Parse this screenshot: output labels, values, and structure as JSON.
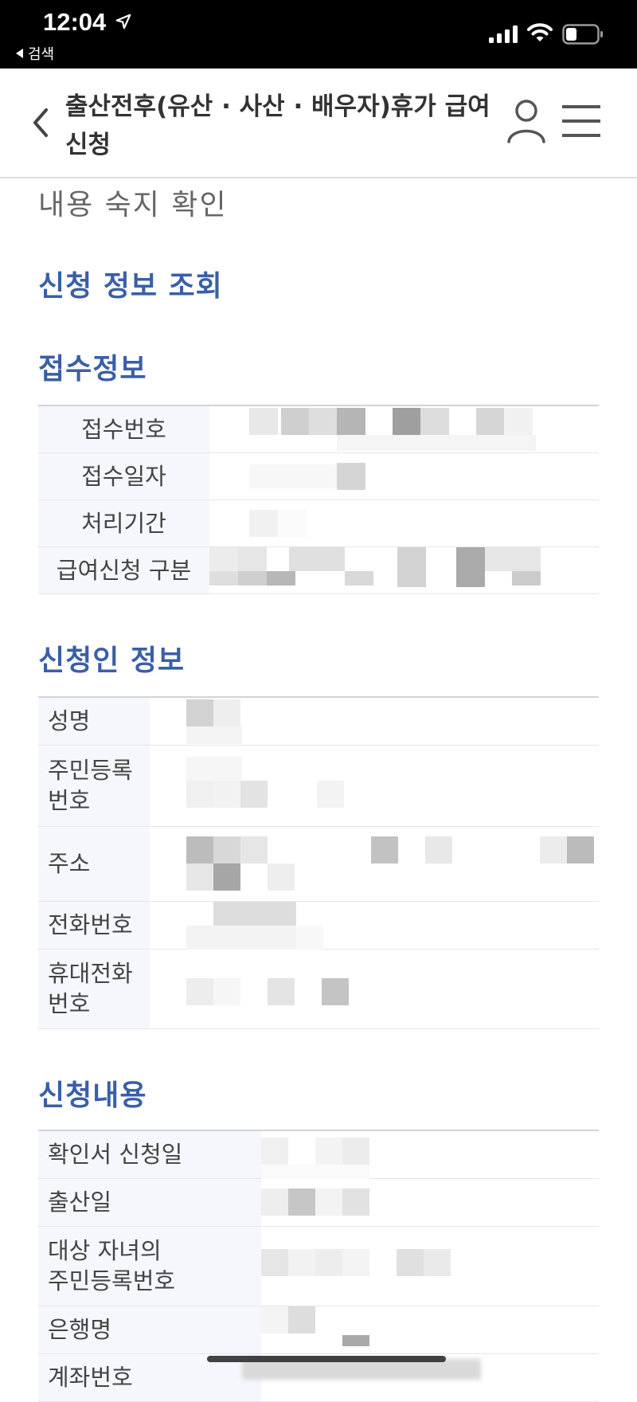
{
  "status_bar": {
    "time": "12:04",
    "back_label": "검색"
  },
  "header": {
    "title": "출산전후(유산 · 사산 · 배우자)휴가 급여 신청"
  },
  "page": {
    "section_title": "내용 숙지 확인",
    "subsection_title": "신청 정보 조회"
  },
  "reception": {
    "title": "접수정보",
    "rows": [
      {
        "label": "접수번호"
      },
      {
        "label": "접수일자"
      },
      {
        "label": "처리기간"
      },
      {
        "label": "급여신청 구분"
      }
    ]
  },
  "applicant": {
    "title": "신청인 정보",
    "rows": [
      {
        "label": "성명"
      },
      {
        "label": "주민등록\n번호"
      },
      {
        "label": "주소"
      },
      {
        "label": "전화번호"
      },
      {
        "label": "휴대전화\n번호"
      }
    ]
  },
  "application": {
    "title": "신청내용",
    "rows": [
      {
        "label": "확인서 신청일"
      },
      {
        "label": "출산일"
      },
      {
        "label": "대상 자녀의\n주민등록번호"
      },
      {
        "label": "은행명"
      },
      {
        "label": "계좌번호"
      }
    ]
  },
  "colors": {
    "accent": "#3a5fa6",
    "label_bg": "#f5f7fc"
  }
}
